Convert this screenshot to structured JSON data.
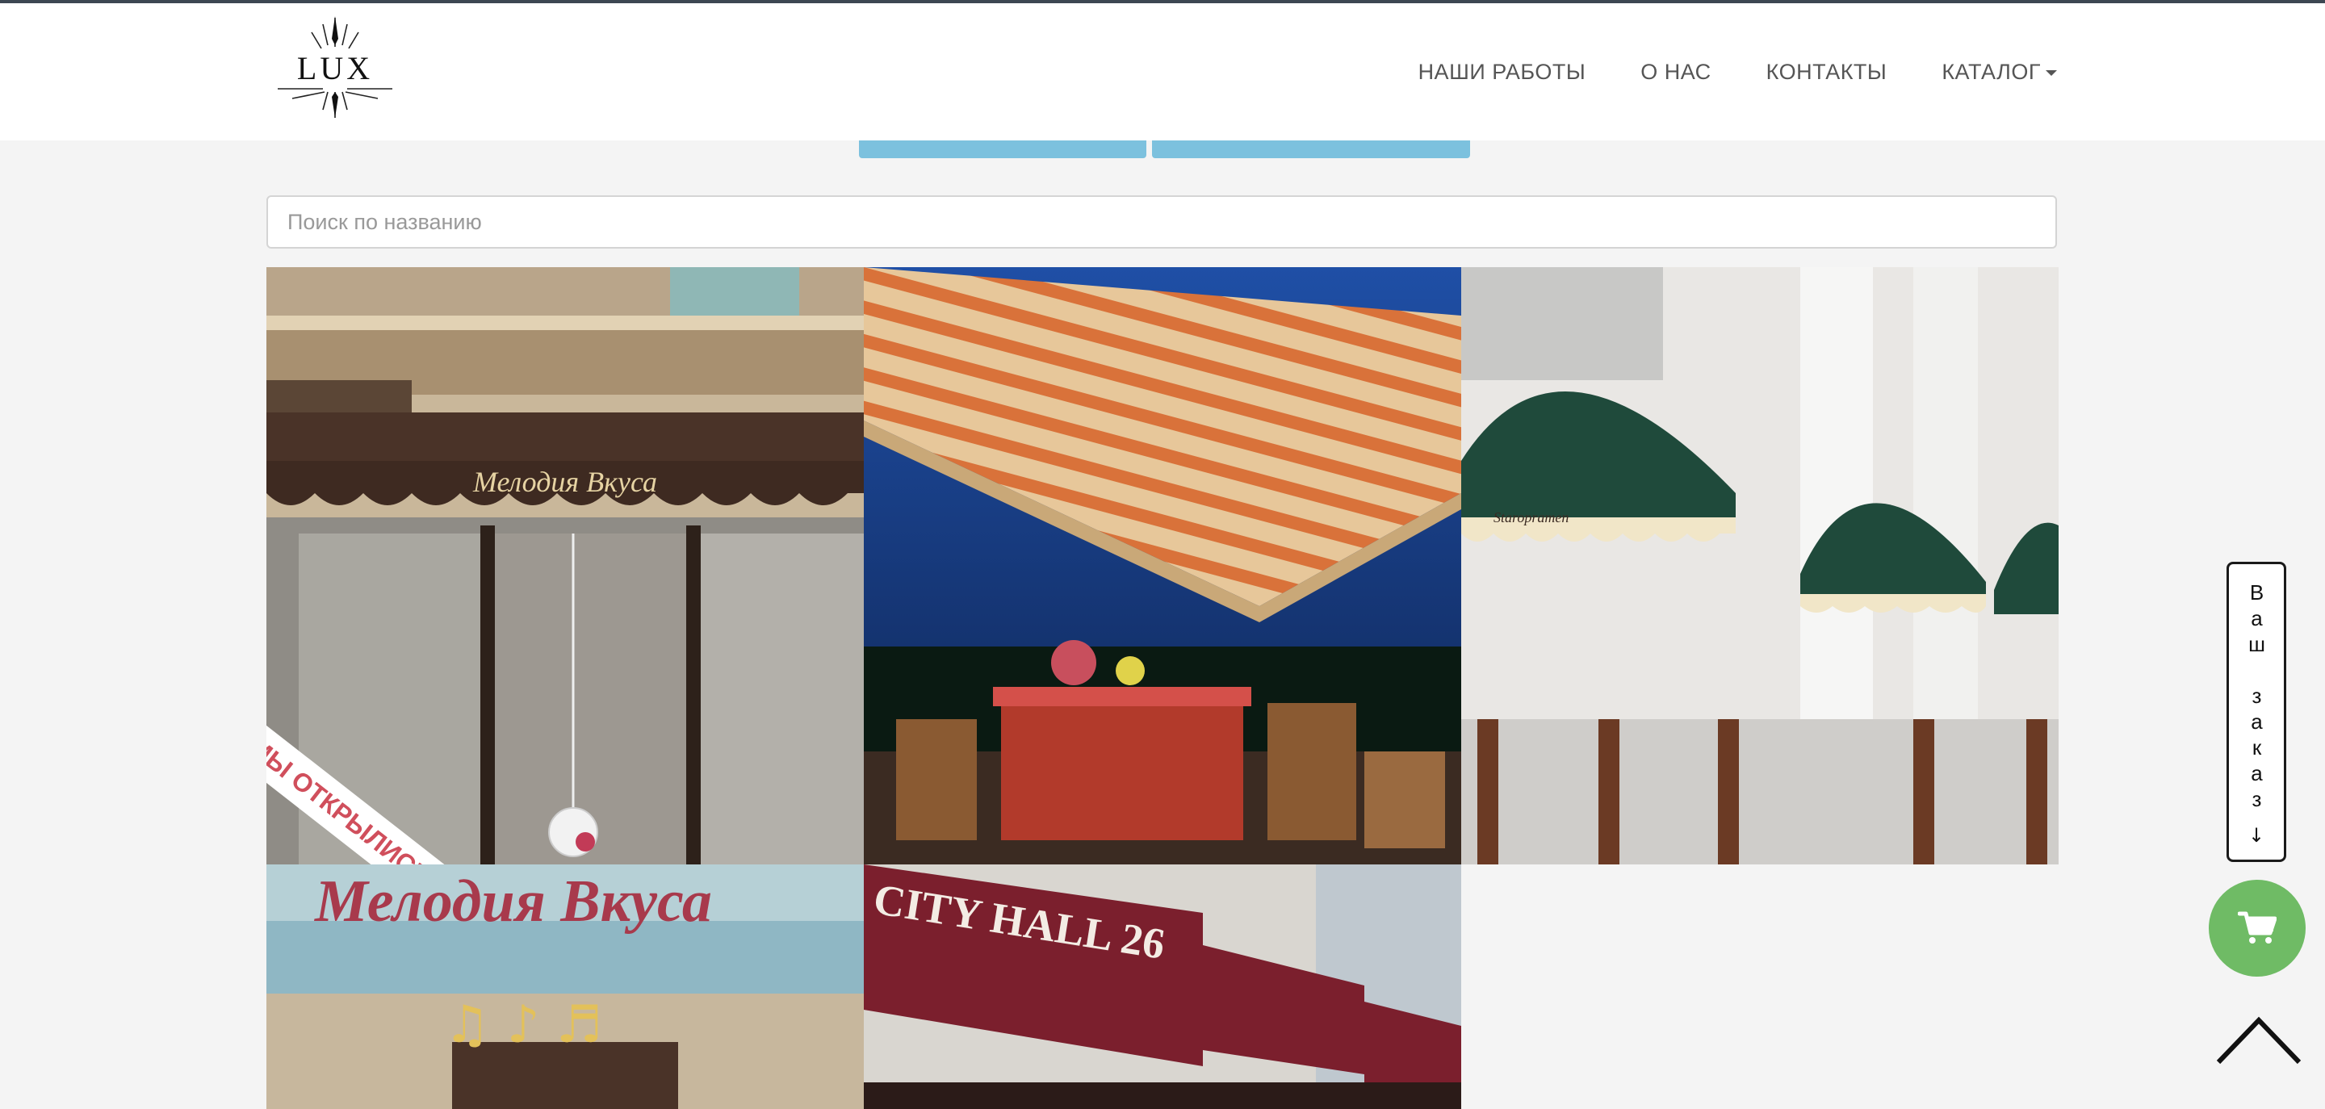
{
  "brand": {
    "logo_text": "LUX"
  },
  "nav": {
    "items": [
      {
        "label": "НАШИ РАБОТЫ"
      },
      {
        "label": "О НАС"
      },
      {
        "label": "КОНТАКТЫ"
      },
      {
        "label": "КАТАЛОГ"
      }
    ]
  },
  "search": {
    "placeholder": "Поиск по названию",
    "value": ""
  },
  "gallery": {
    "items": [
      {
        "signage": "Мелодия Вкуса",
        "sticker": "МЫ ОТКРЫЛИСЬ"
      },
      {
        "signage": ""
      },
      {
        "signage": "Staropramen"
      },
      {
        "signage": "Мелодия Вкуса"
      },
      {
        "signage": "CITY HALL 26"
      }
    ]
  },
  "order_panel": {
    "label": "Ваш заказ"
  },
  "colors": {
    "accent_green": "#6fbb65",
    "filter_blue": "#7cc1de",
    "awning_green": "#1f4a3b",
    "awning_maroon": "#8a2a36"
  },
  "icons": {
    "cart": "shopping-cart-icon",
    "up": "chevron-up-icon",
    "down": "arrow-down-icon"
  }
}
